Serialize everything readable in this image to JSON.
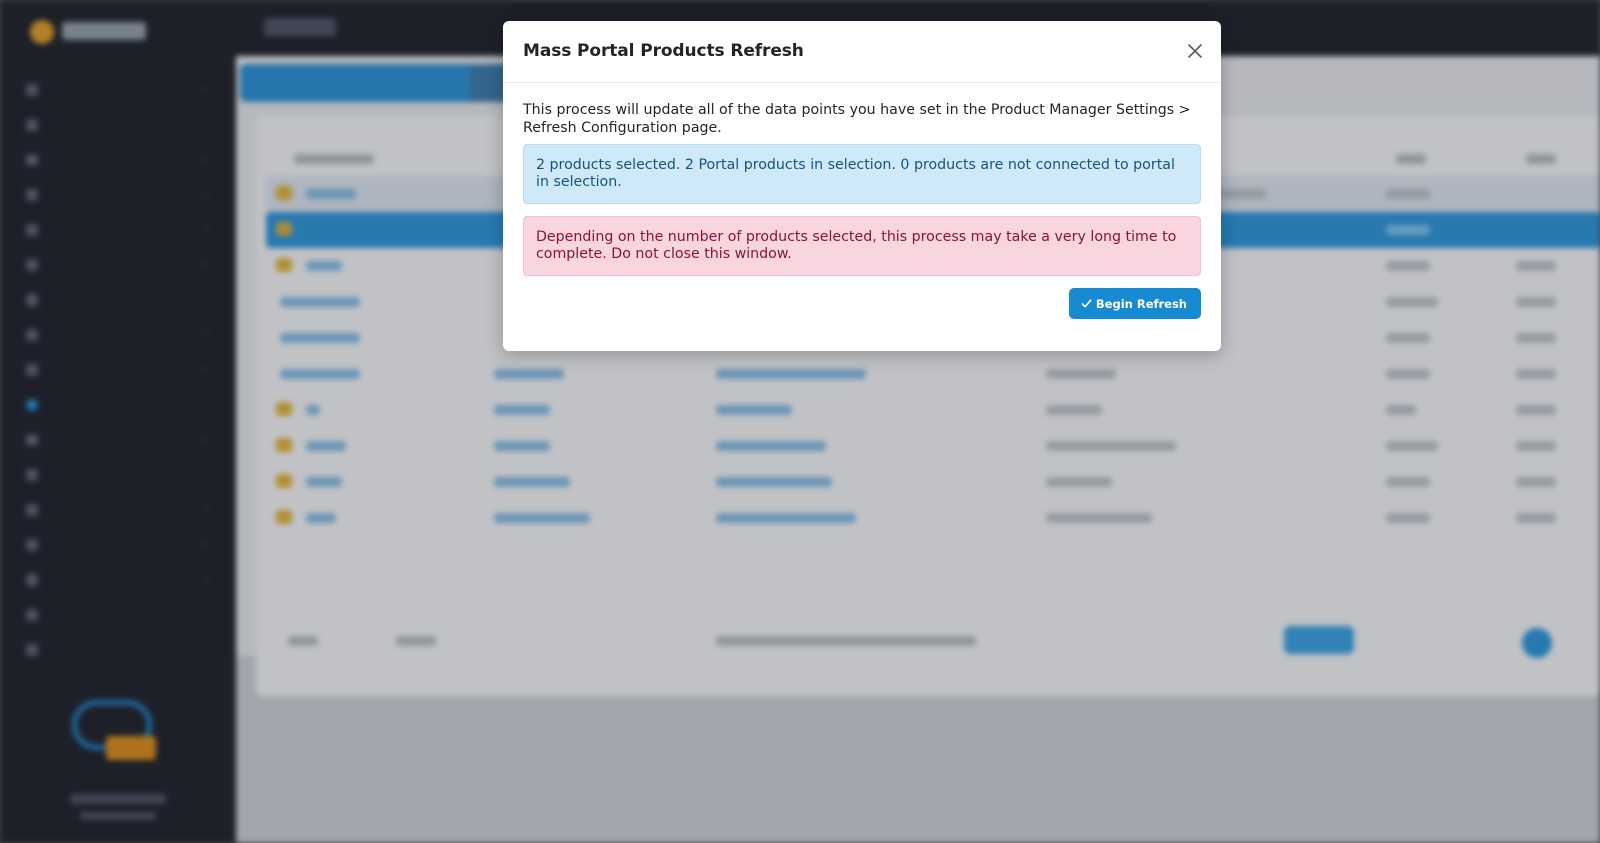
{
  "modal": {
    "title": "Mass Portal Products Refresh",
    "description": "This process will update all of the data points you have set in the Product Manager Settings > Refresh Configuration page.",
    "info_alert": "2 products selected. 2 Portal products in selection. 0 products are not connected to portal in selection.",
    "warning_alert": "Depending on the number of products selected, this process may take a very long time to complete. Do not close this window.",
    "begin_button_label": "Begin Refresh",
    "close_icon": "close-icon",
    "check_icon": "check-icon"
  },
  "colors": {
    "primary": "#168bd1",
    "info_bg": "#cfe9f8",
    "info_text": "#13557d",
    "danger_bg": "#f9d6df",
    "danger_text": "#86152f",
    "sidebar_bg": "#20232d"
  }
}
